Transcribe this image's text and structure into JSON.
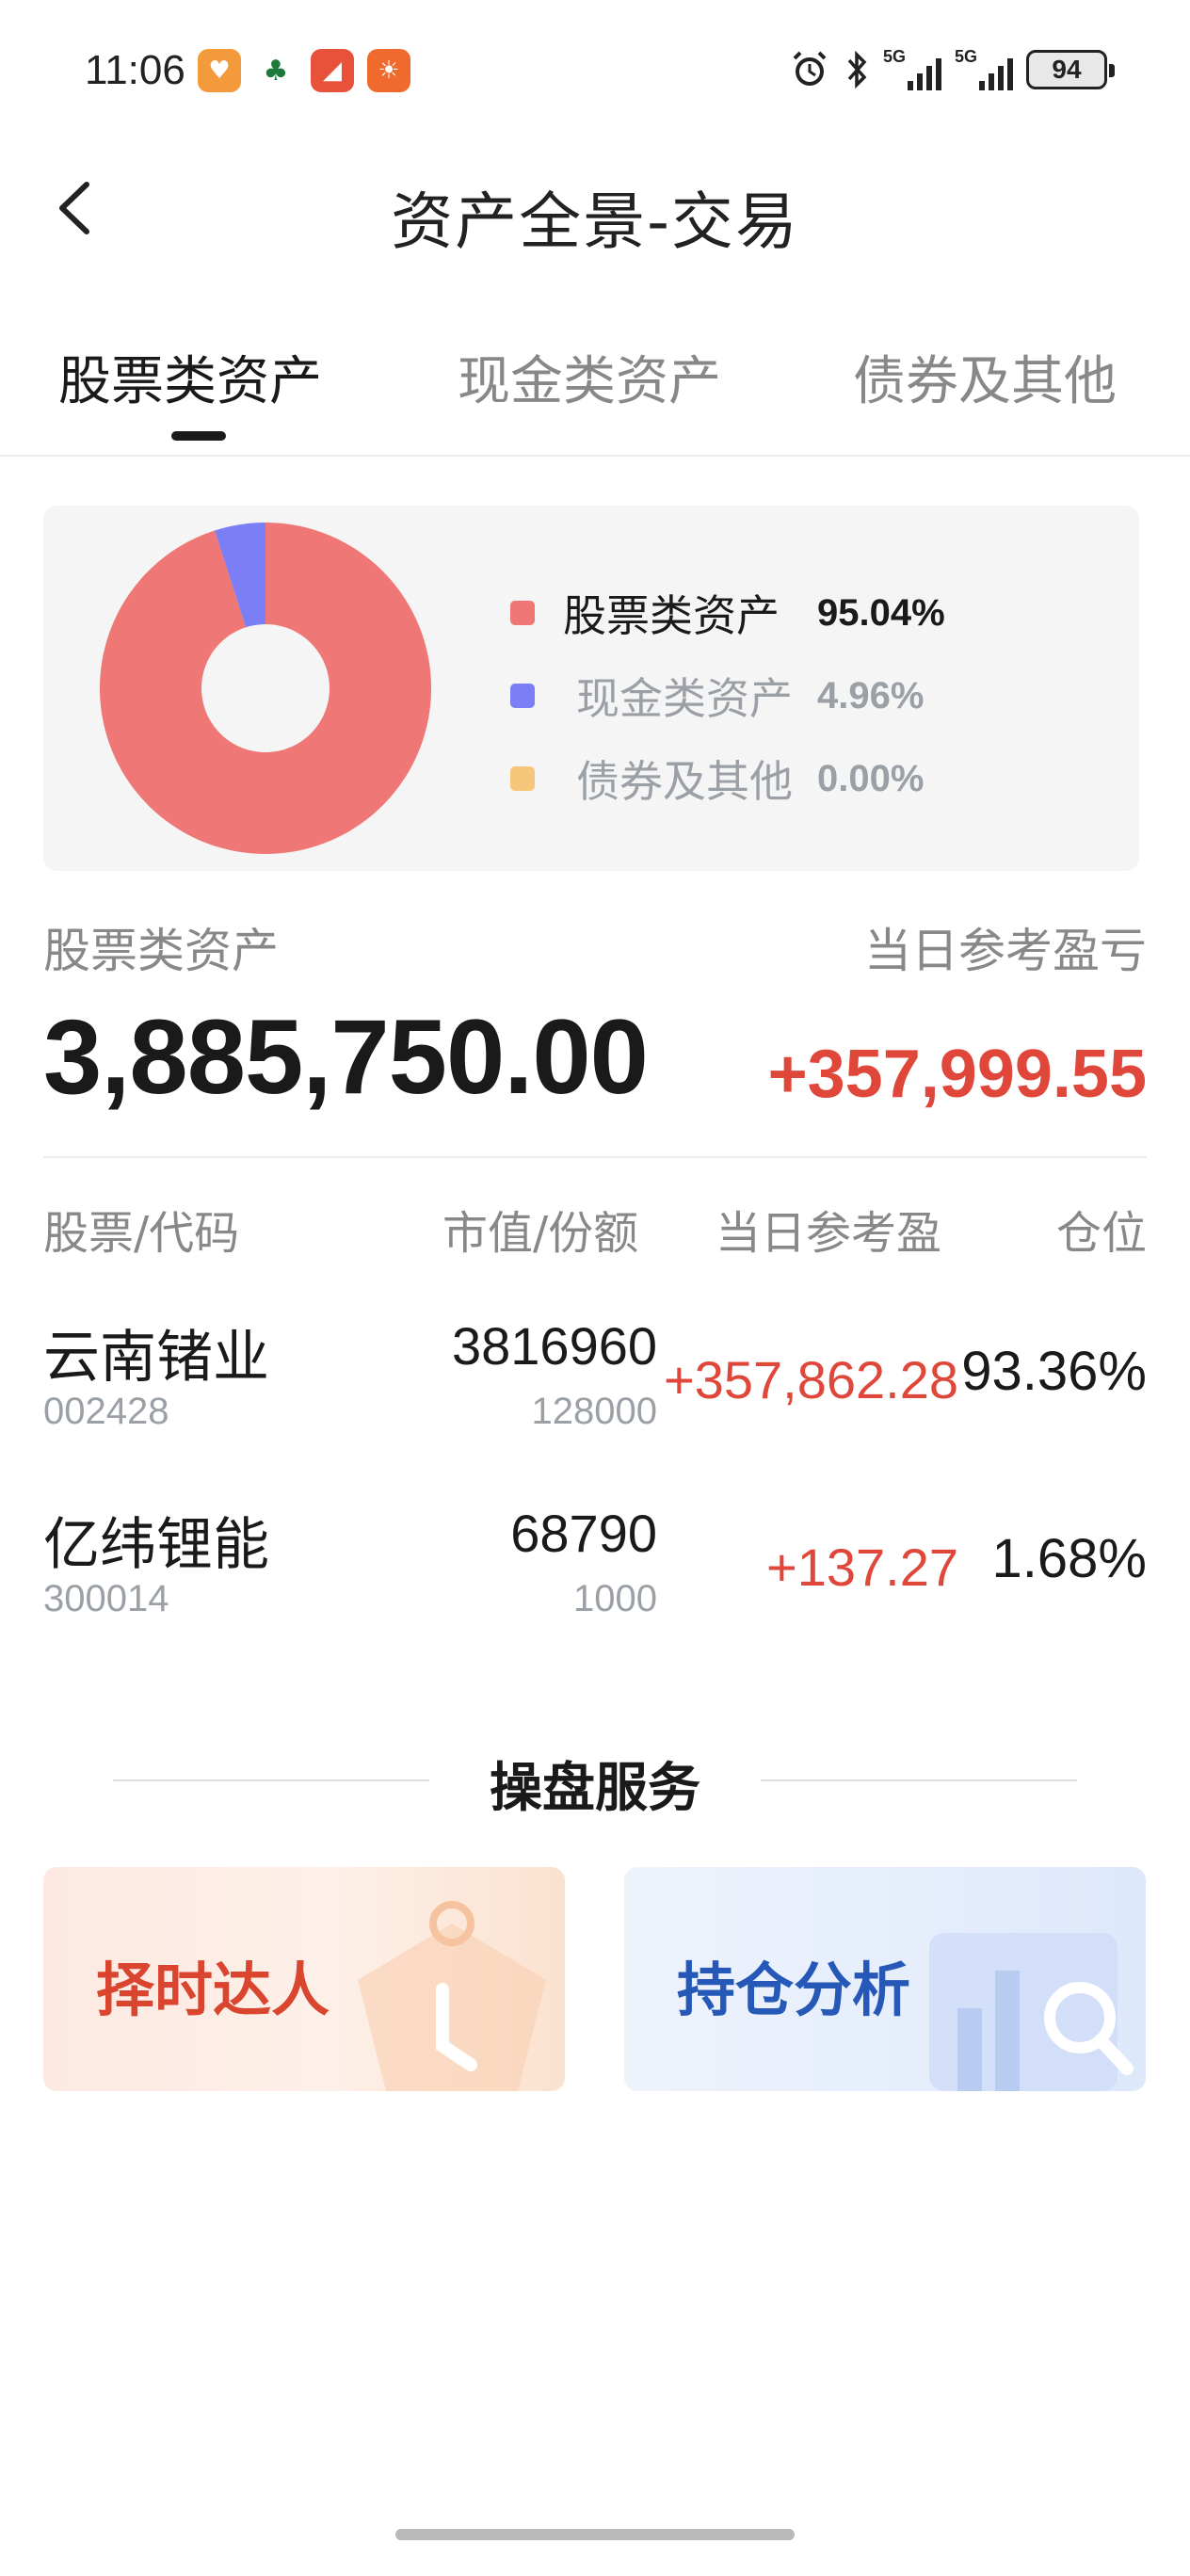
{
  "status_bar": {
    "time": "11:06",
    "signal1_label": "5G",
    "signal2_label": "5G",
    "battery": "94"
  },
  "header": {
    "title": "资产全景-交易"
  },
  "tabs": [
    {
      "label": "股票类资产",
      "active": true
    },
    {
      "label": "现金类资产",
      "active": false
    },
    {
      "label": "债券及其他",
      "active": false
    }
  ],
  "chart_data": {
    "type": "pie",
    "donut": true,
    "categories": [
      "股票类资产",
      "现金类资产",
      "债券及其他"
    ],
    "values": [
      95.04,
      4.96,
      0.0
    ],
    "value_labels": [
      "95.04%",
      "4.96%",
      "0.00%"
    ],
    "colors": [
      "#ef7775",
      "#7c7ef5",
      "#f6c77a"
    ],
    "title": "",
    "legend_position": "right"
  },
  "summary": {
    "label_left": "股票类资产",
    "value_left": "3,885,750.00",
    "label_right": "当日参考盈亏",
    "value_right": "+357,999.55"
  },
  "table": {
    "headers": [
      "股票/代码",
      "市值/份额",
      "当日参考盈",
      "仓位"
    ],
    "rows": [
      {
        "name": "云南锗业",
        "code": "002428",
        "market_value": "3816960",
        "shares": "128000",
        "pl": "+357,862.28",
        "position": "93.36%"
      },
      {
        "name": "亿纬锂能",
        "code": "300014",
        "market_value": "68790",
        "shares": "1000",
        "pl": "+137.27",
        "position": "1.68%"
      }
    ]
  },
  "service": {
    "title": "操盘服务",
    "cards": [
      {
        "label": "择时达人",
        "color": "#d9452e"
      },
      {
        "label": "持仓分析",
        "color": "#2658b8"
      }
    ]
  }
}
